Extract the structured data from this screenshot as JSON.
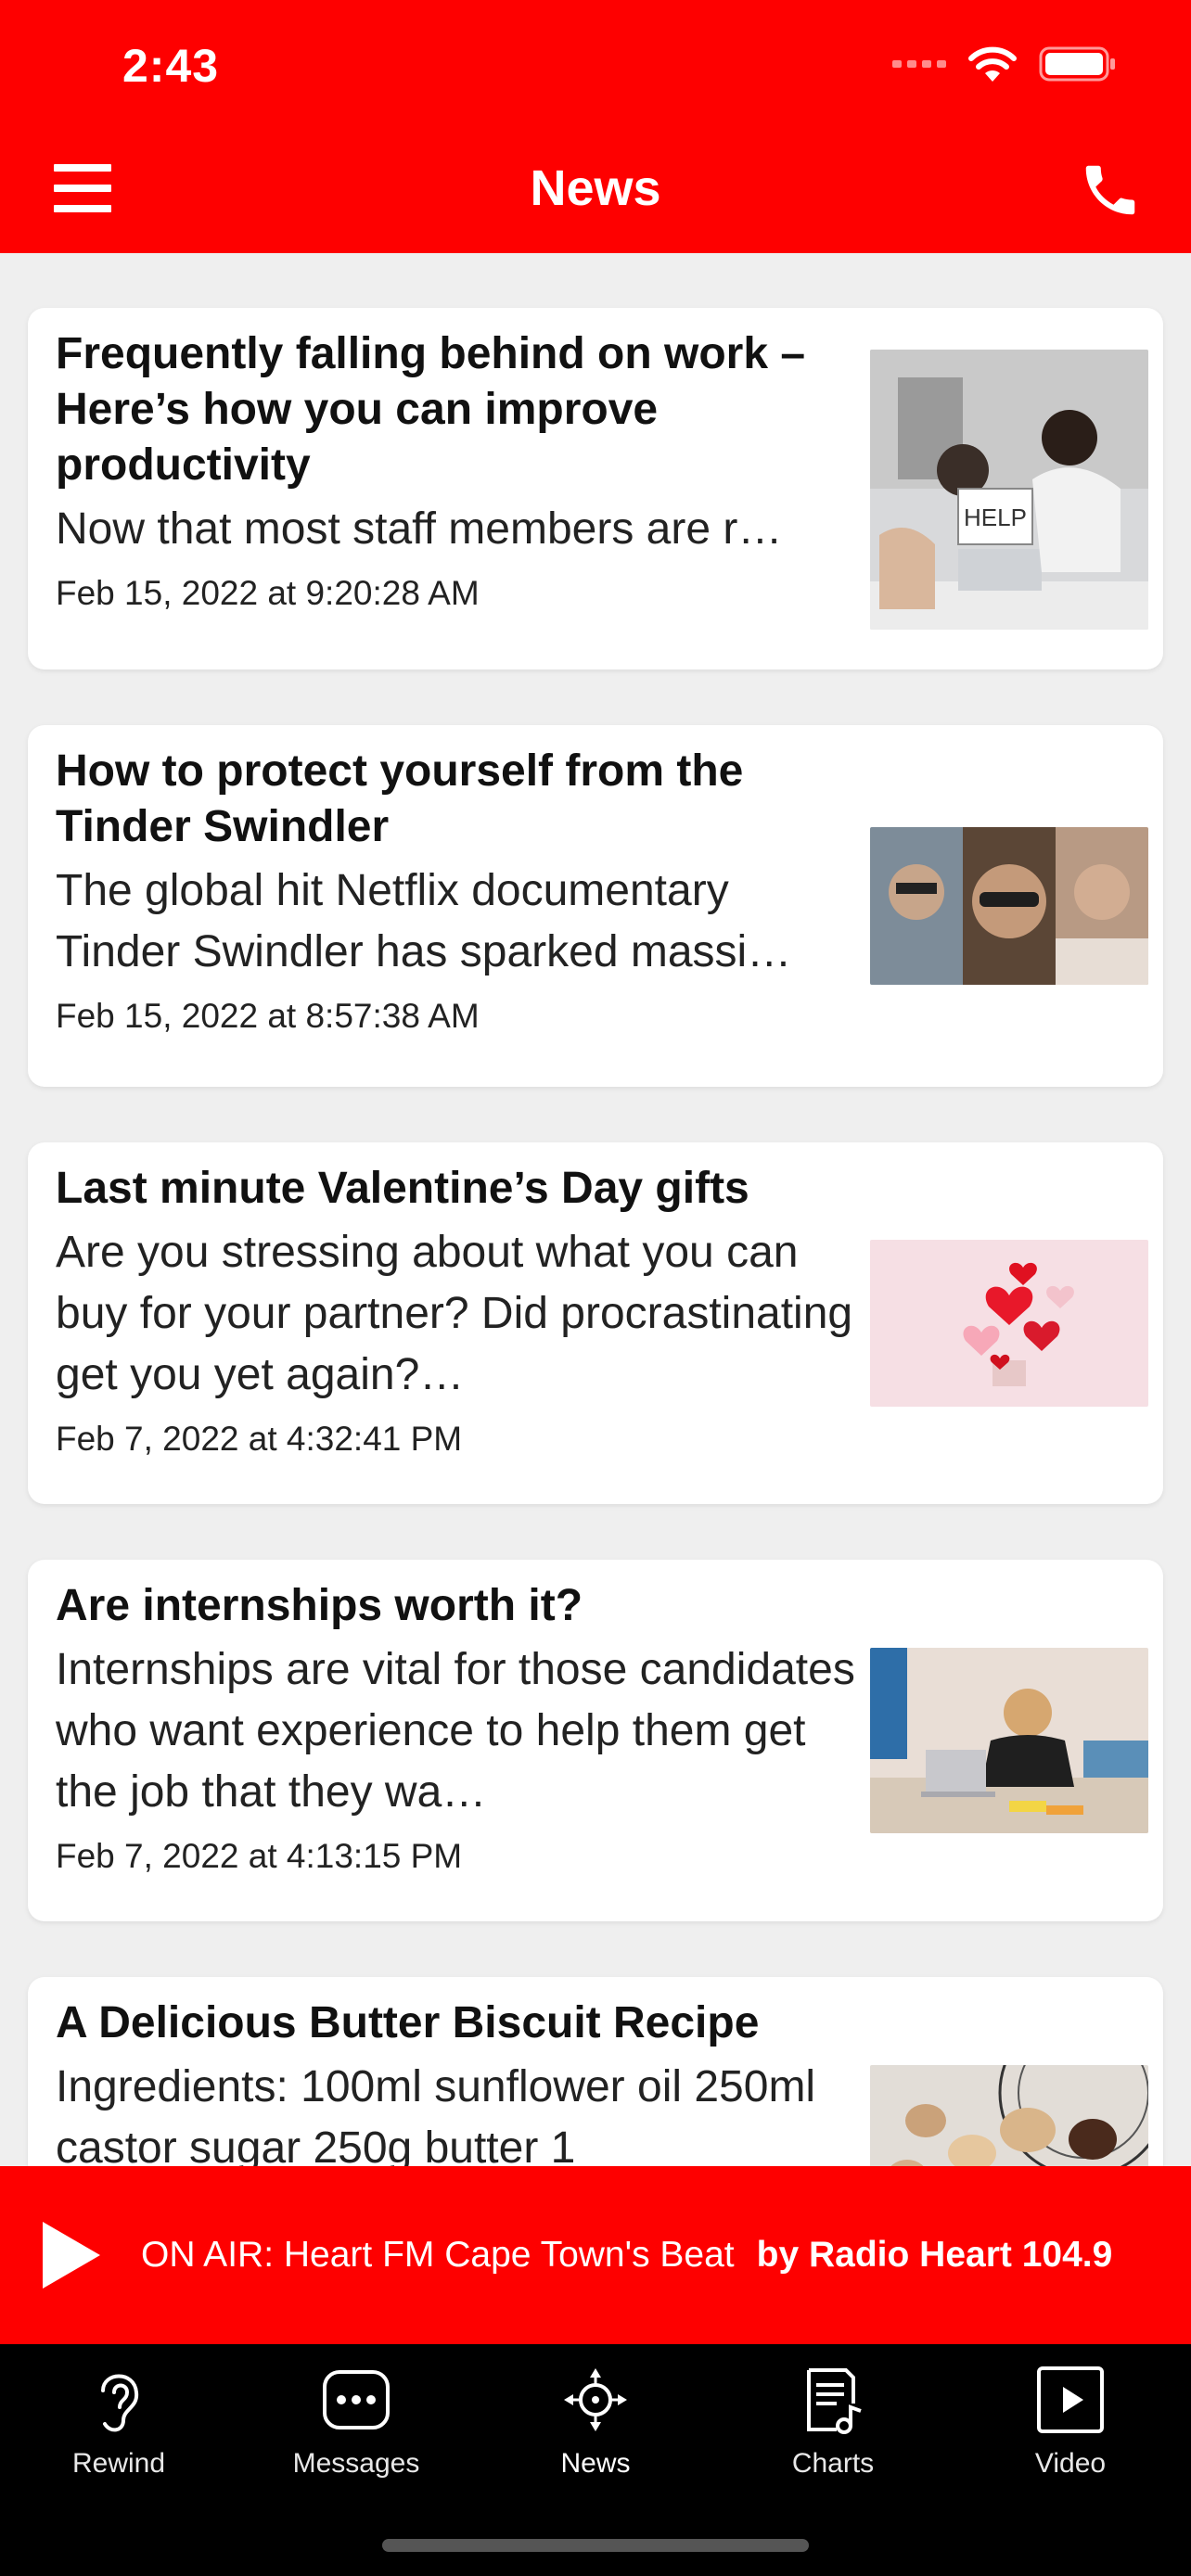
{
  "status_bar": {
    "time": "2:43"
  },
  "header": {
    "title": "News"
  },
  "articles": [
    {
      "title": "Frequently falling behind on work – Here’s how you can improve productivity",
      "excerpt": "Now that most staff members are r…",
      "date": "Feb 15, 2022 at 9:20:28 AM",
      "image": "office-help-sign-photo",
      "image_sign_text": "HELP"
    },
    {
      "title": "How to protect yourself from the Tinder Swindler",
      "excerpt": "The global hit Netflix documentary Tinder Swindler has sparked massi…",
      "date": "Feb 15, 2022 at 8:57:38 AM",
      "image": "man-sunglasses-collage-photo"
    },
    {
      "title": "Last minute Valentine’s Day gifts",
      "excerpt": "Are you stressing about what you can buy for your partner? Did procrastinating get you yet again?…",
      "date": "Feb 7, 2022 at 4:32:41 PM",
      "image": "paper-hearts-gift-photo"
    },
    {
      "title": "Are internships worth it?",
      "excerpt": "Internships are vital for those candidates who want experience to help them get the job that they wa…",
      "date": "Feb 7, 2022 at 4:13:15 PM",
      "image": "woman-at-laptop-photo"
    },
    {
      "title": "A Delicious Butter Biscuit Recipe",
      "excerpt": "Ingredients: 100ml sunflower oil 250ml castor sugar 250g butter 1",
      "date": "",
      "image": "biscuits-on-rack-photo"
    }
  ],
  "player": {
    "on_air": "ON AIR: Heart FM Cape Town's Beat",
    "station": "by Radio Heart 104.9"
  },
  "tabs": [
    {
      "label": "Rewind",
      "icon": "ear-icon",
      "active": false
    },
    {
      "label": "Messages",
      "icon": "chat-bubble-icon",
      "active": false
    },
    {
      "label": "News",
      "icon": "news-compass-icon",
      "active": true
    },
    {
      "label": "Charts",
      "icon": "charts-list-icon",
      "active": false
    },
    {
      "label": "Video",
      "icon": "video-play-icon",
      "active": false
    }
  ],
  "colors": {
    "brand_red": "#fe0000",
    "tabbar_bg": "#000000",
    "feed_bg": "#efefef"
  }
}
